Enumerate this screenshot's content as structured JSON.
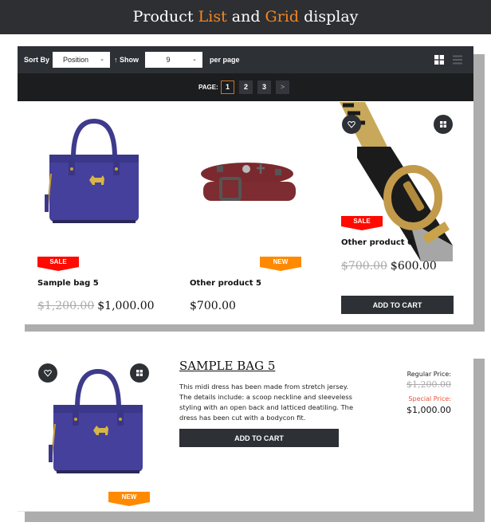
{
  "banner": {
    "words": [
      "Product",
      "List",
      "and",
      "Grid",
      "display"
    ]
  },
  "colors": {
    "accent": "#f7861d",
    "dark": "#2d3035",
    "sale": "#ff0a00",
    "new": "#ff8a00",
    "special_price": "#e8543b"
  },
  "toolbar": {
    "sort_label": "Sort By",
    "sort_value": "Position",
    "sort_direction_icon": "arrow-up-icon",
    "show_label": "Show",
    "show_value": "9",
    "per_page_label": "per page",
    "grid_view_icon": "grid-icon",
    "list_view_icon": "list-icon"
  },
  "pager": {
    "label": "PAGE:",
    "pages": [
      "1",
      "2",
      "3"
    ],
    "current": "1",
    "next_icon": "chevron-right-icon",
    "next_label": ">"
  },
  "grid": {
    "products": [
      {
        "name": "Sample bag 5",
        "badge": "SALE",
        "old_price": "$1,200.00",
        "price": "$1,000.00"
      },
      {
        "name": "Other product 5",
        "badge": "NEW",
        "old_price": "",
        "price": "$700.00"
      },
      {
        "name": "Other product 6",
        "badge": "SALE",
        "old_price": "$700.00",
        "price": "$600.00",
        "add_to_cart": "ADD TO CART",
        "hover": true
      }
    ]
  },
  "list": {
    "title": "SAMPLE BAG 5",
    "description": "This midi dress has been made from stretch jersey. The details include: a scoop neckline and sleeveless styling with an open back and latticed deatiling. The dress has been cut with a bodycon fit.",
    "add_to_cart": "ADD TO CART",
    "badge": "NEW",
    "regular_price_label": "Regular Price:",
    "regular_price": "$1,200.00",
    "special_price_label": "Special Price:",
    "special_price": "$1,000.00"
  }
}
